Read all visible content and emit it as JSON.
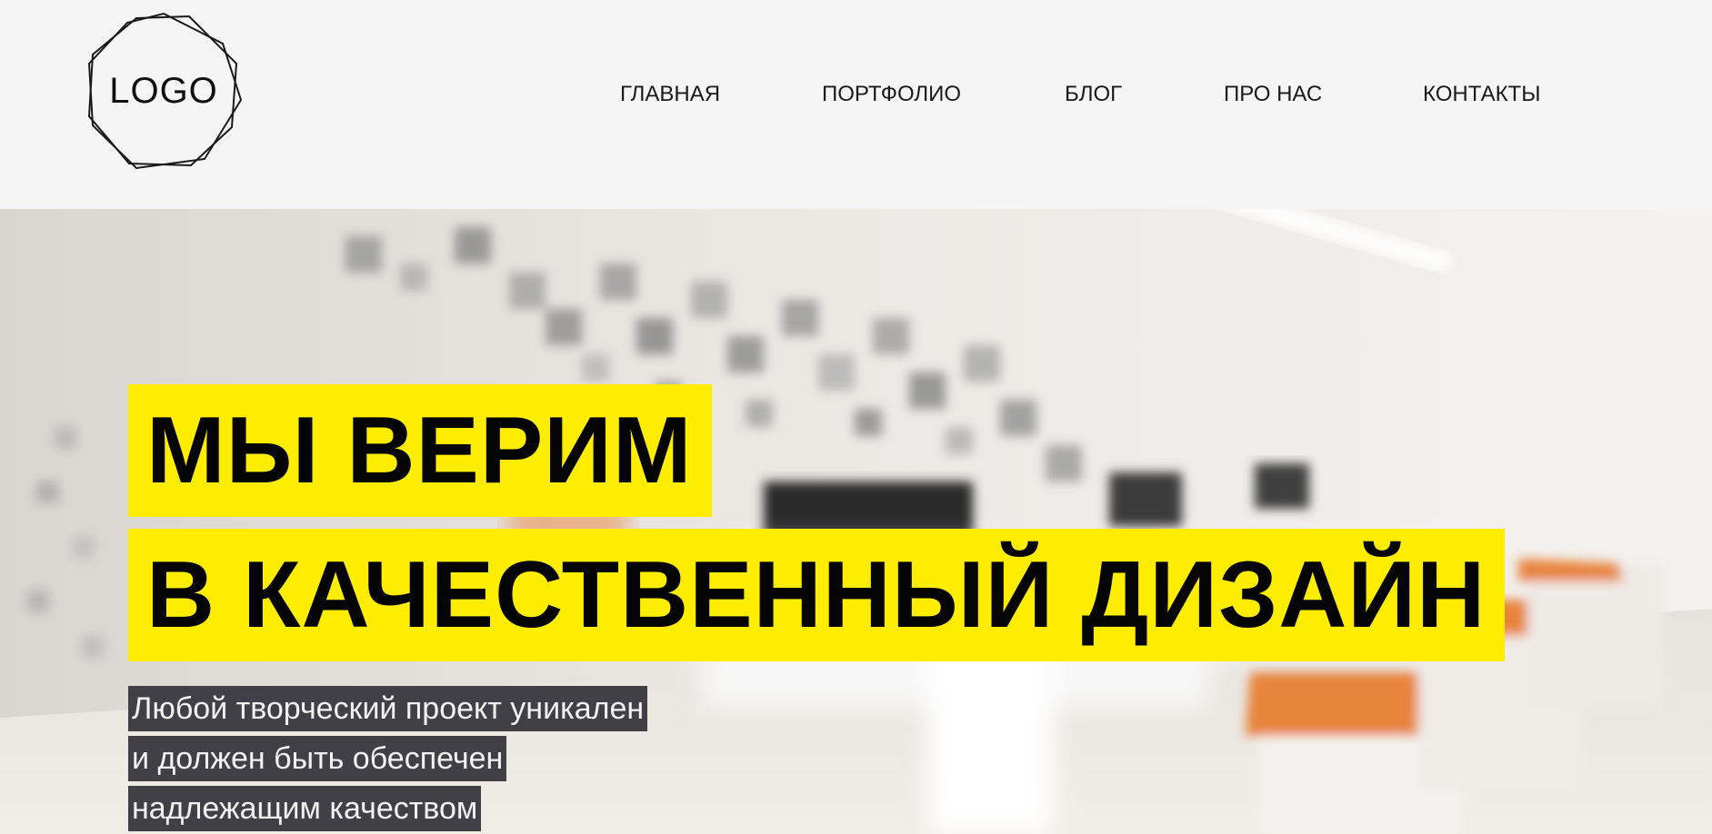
{
  "header": {
    "logo_text": "LOGO",
    "nav": [
      {
        "label": "ГЛАВНАЯ"
      },
      {
        "label": "ПОРТФОЛИО"
      },
      {
        "label": "БЛОГ"
      },
      {
        "label": "ПРО НАС"
      },
      {
        "label": "КОНТАКТЫ"
      }
    ]
  },
  "hero": {
    "headline_line_1": "МЫ ВЕРИМ",
    "headline_line_2": "В КАЧЕСТВЕННЫЙ ДИЗАЙН",
    "subtitle_lines": [
      "Любой творческий проект уникален",
      "и должен быть обеспечен",
      "надлежащим качеством"
    ]
  },
  "colors": {
    "header_background": "#f5f5f5",
    "headline_highlight": "#ffed00",
    "headline_text": "#050505",
    "subtitle_background": "#414046",
    "subtitle_text": "#f2f2f2",
    "accent_orange": "#e8833a"
  },
  "icons": {
    "logo": "octagram-outline-logo-icon"
  }
}
